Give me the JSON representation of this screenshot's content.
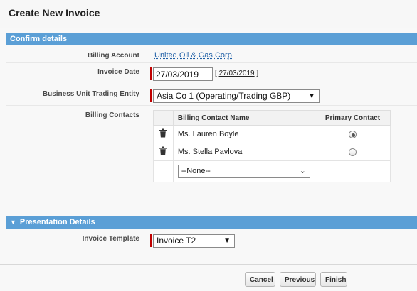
{
  "page": {
    "title": "Create New Invoice"
  },
  "sections": {
    "confirm": {
      "title": "Confirm details",
      "collapse_icon": "none"
    },
    "presentation": {
      "title": "Presentation Details",
      "collapse_icon": "triangle-down"
    }
  },
  "fields": {
    "billing_account": {
      "label": "Billing Account",
      "value": "United Oil & Gas Corp."
    },
    "invoice_date": {
      "label": "Invoice Date",
      "value": "27/03/2019",
      "hint_open": "[",
      "hint_link": "27/03/2019",
      "hint_close": "]"
    },
    "business_unit": {
      "label": "Business Unit Trading Entity",
      "value": "Asia Co 1 (Operating/Trading GBP)"
    },
    "billing_contacts": {
      "label": "Billing Contacts",
      "columns": [
        "Billing Contact Name",
        "Primary Contact"
      ],
      "rows": [
        {
          "name": "Ms. Lauren Boyle",
          "primary": true
        },
        {
          "name": "Ms. Stella Pavlova",
          "primary": false
        }
      ],
      "new_row_select": "--None--"
    },
    "invoice_template": {
      "label": "Invoice Template",
      "value": "Invoice T2"
    }
  },
  "footer": {
    "cancel": "Cancel",
    "previous": "Previous",
    "finish": "Finish"
  },
  "colors": {
    "section_header": "#5b9fd6",
    "link": "#1f5fa6",
    "required": "#c00000"
  }
}
